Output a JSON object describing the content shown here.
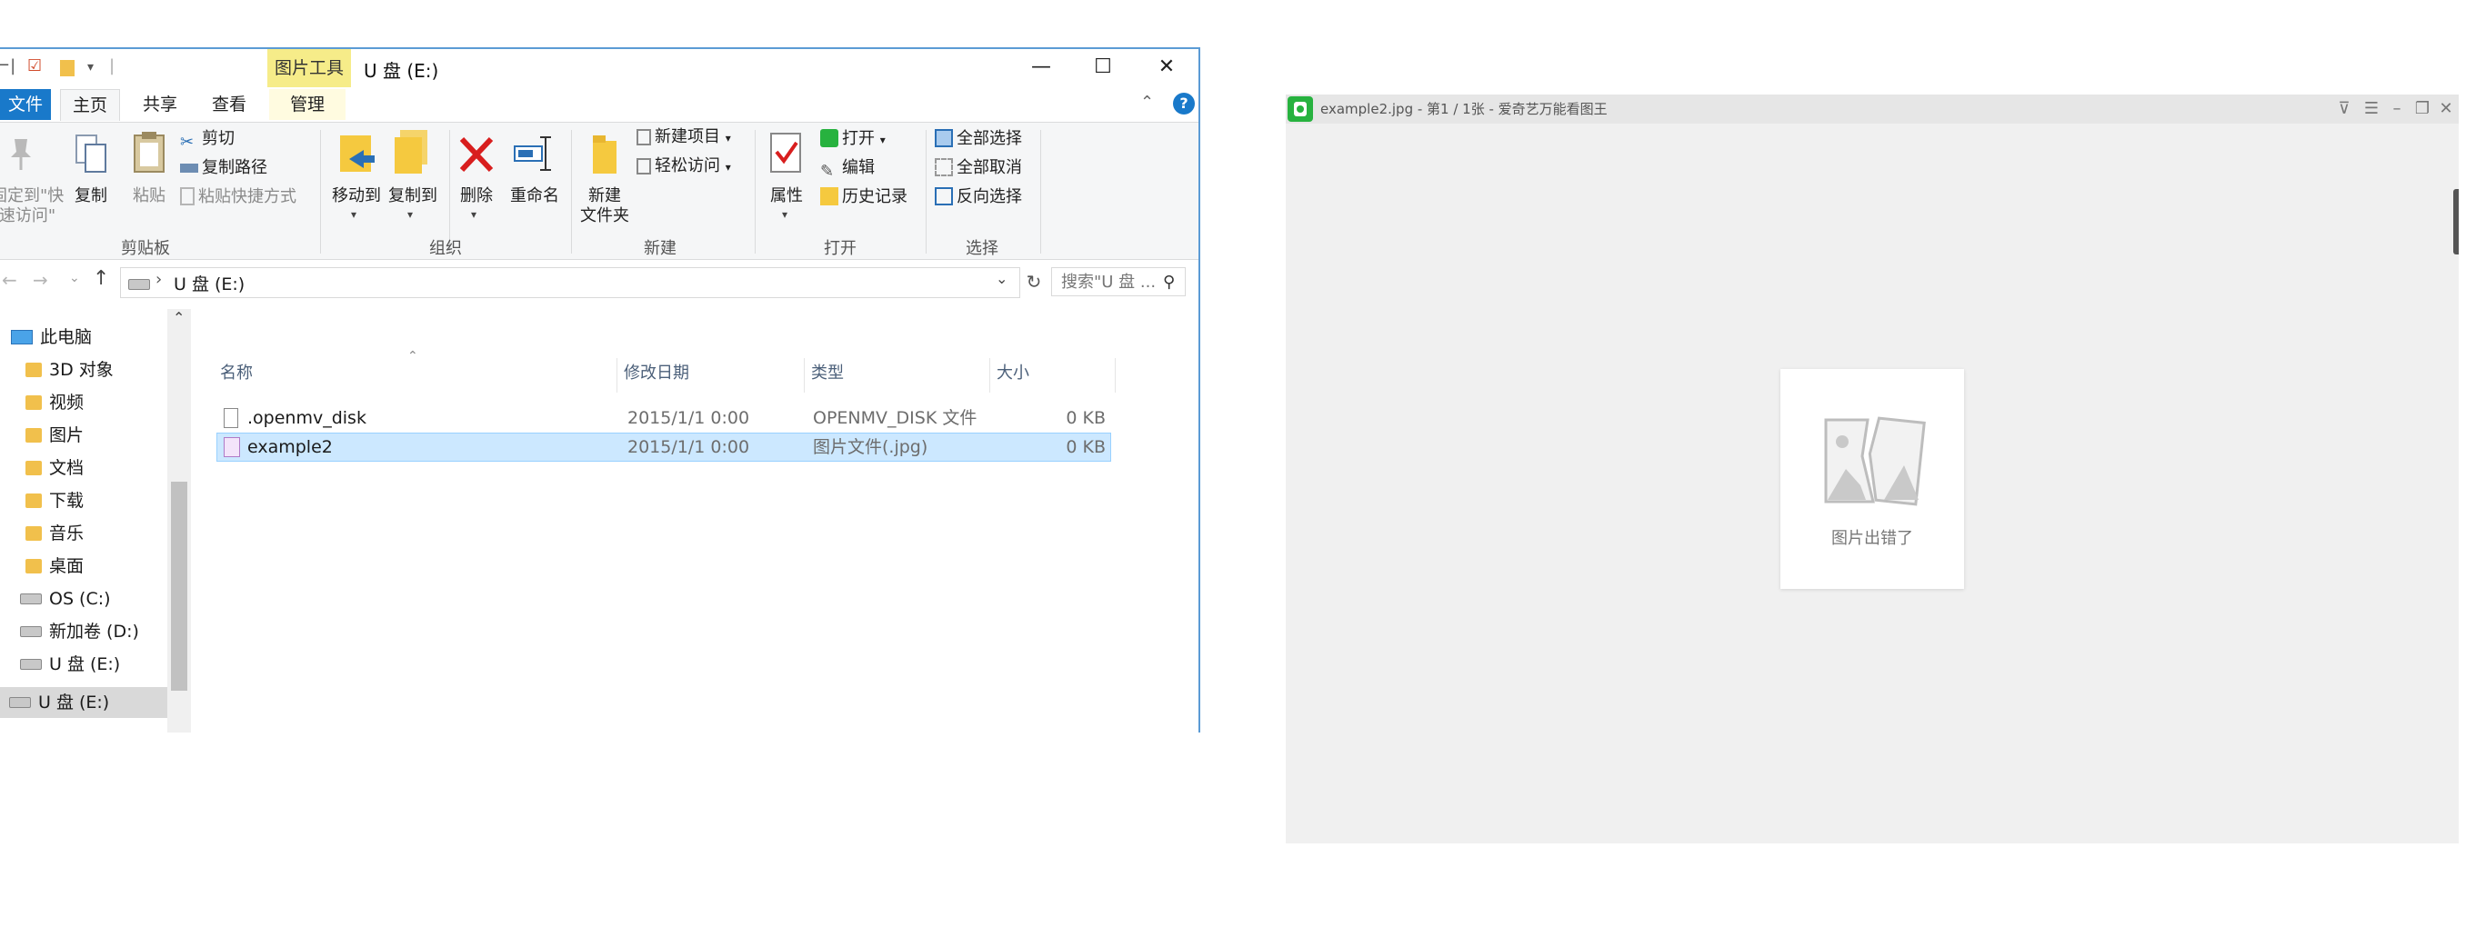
{
  "explorer": {
    "title": "U 盘 (E:)",
    "context_tab_header": "图片工具",
    "tabs": {
      "file": "文件",
      "home": "主页",
      "share": "共享",
      "view": "查看",
      "manage": "管理"
    },
    "ribbon": {
      "clipboard": {
        "group_label": "剪贴板",
        "pin_label": "固定到\"快\n速访问\"",
        "copy_label": "复制",
        "paste_label": "粘贴",
        "cut_label": "剪切",
        "copy_path_label": "复制路径",
        "paste_shortcut_label": "粘贴快捷方式"
      },
      "organize": {
        "group_label": "组织",
        "move_to_label": "移动到",
        "copy_to_label": "复制到",
        "delete_label": "删除",
        "rename_label": "重命名"
      },
      "new": {
        "group_label": "新建",
        "new_folder_label": "新建\n文件夹",
        "new_item_label": "新建项目",
        "easy_access_label": "轻松访问"
      },
      "open": {
        "group_label": "打开",
        "properties_label": "属性",
        "open_label": "打开",
        "edit_label": "编辑",
        "history_label": "历史记录"
      },
      "select": {
        "group_label": "选择",
        "select_all_label": "全部选择",
        "select_none_label": "全部取消",
        "invert_label": "反向选择"
      }
    },
    "address": {
      "path": "U 盘 (E:)",
      "search_placeholder": "搜索\"U 盘 ..."
    },
    "nav": [
      {
        "label": "此电脑",
        "icon": "pc-icon"
      },
      {
        "label": "3D 对象",
        "icon": "folder-icon"
      },
      {
        "label": "视频",
        "icon": "folder-icon"
      },
      {
        "label": "图片",
        "icon": "folder-icon"
      },
      {
        "label": "文档",
        "icon": "folder-icon"
      },
      {
        "label": "下载",
        "icon": "folder-icon"
      },
      {
        "label": "音乐",
        "icon": "folder-icon"
      },
      {
        "label": "桌面",
        "icon": "folder-icon"
      },
      {
        "label": "OS (C:)",
        "icon": "drive-icon"
      },
      {
        "label": "新加卷 (D:)",
        "icon": "drive-icon"
      },
      {
        "label": "U 盘 (E:)",
        "icon": "drive-icon"
      },
      {
        "label": "U 盘 (E:)",
        "icon": "drive-icon"
      }
    ],
    "columns": {
      "name": "名称",
      "date": "修改日期",
      "type": "类型",
      "size": "大小"
    },
    "files": [
      {
        "name": ".openmv_disk",
        "date": "2015/1/1 0:00",
        "type": "OPENMV_DISK 文件",
        "size": "0 KB",
        "icon": "file-icon"
      },
      {
        "name": "example2",
        "date": "2015/1/1 0:00",
        "type": "图片文件(.jpg)",
        "size": "0 KB",
        "icon": "image-file-icon"
      }
    ]
  },
  "viewer": {
    "title": "example2.jpg - 第1 / 1张 - 爱奇艺万能看图王",
    "error_text": "图片出错了",
    "accent": "#27b23f"
  }
}
